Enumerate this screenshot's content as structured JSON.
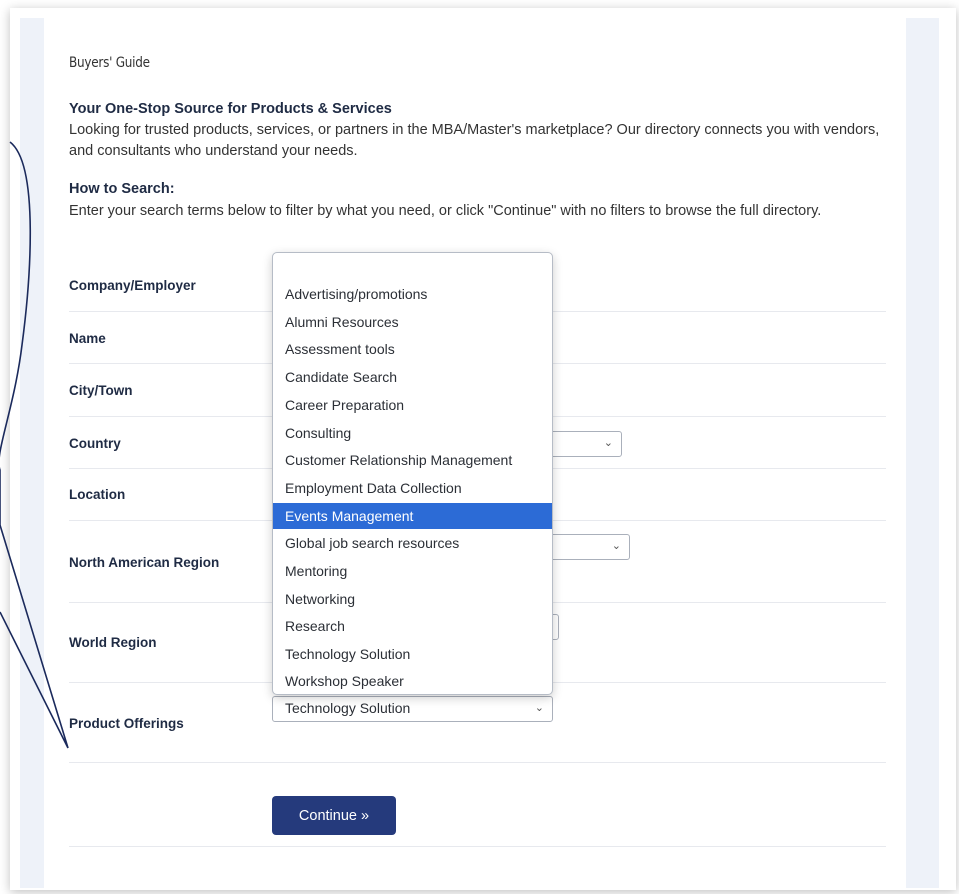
{
  "breadcrumb": "Buyers' Guide",
  "intro": {
    "heading": "Your One-Stop Source for Products & Services",
    "text": "Looking for trusted products, services, or partners in the MBA/Master's marketplace? Our directory connects you with vendors, and consultants who understand your needs."
  },
  "how_to": {
    "heading": "How to Search:",
    "text": "Enter your search terms below to filter by what you need, or click \"Continue\" with no filters to browse the full directory."
  },
  "fields": {
    "company": "Company/Employer",
    "name": "Name",
    "city": "City/Town",
    "country": "Country",
    "location": "Location",
    "na_region": "North American Region",
    "world_region": "World Region",
    "product": "Product Offerings"
  },
  "product_dropdown": {
    "options": [
      "Advertising/promotions",
      "Alumni Resources",
      "Assessment tools",
      "Candidate Search",
      "Career Preparation",
      "Consulting",
      "Customer Relationship Management",
      "Employment Data Collection",
      "Events Management",
      "Global job search resources",
      "Mentoring",
      "Networking",
      "Research",
      "Technology Solution",
      "Workshop Speaker"
    ],
    "highlighted": "Events Management",
    "selected_value": "Technology Solution"
  },
  "continue_label": "Continue »",
  "colors": {
    "button": "#253a7c",
    "highlight": "#2c6bd6",
    "callout_stroke": "#1b2a5c"
  }
}
